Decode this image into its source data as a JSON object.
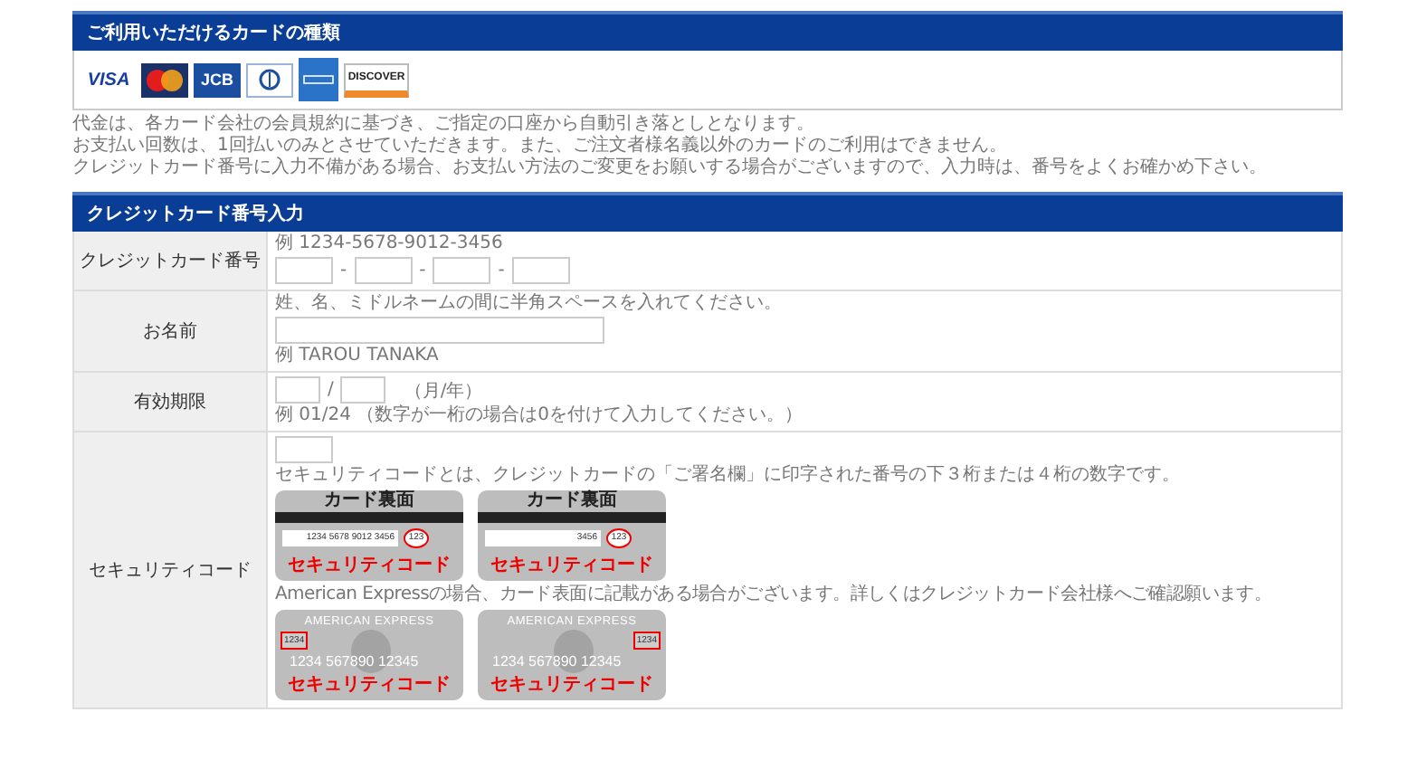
{
  "cards_section": {
    "title": "ご利用いただけるカードの種類",
    "card_brands": [
      {
        "kind": "visa",
        "label": "VISA"
      },
      {
        "kind": "mastercard"
      },
      {
        "kind": "jcb",
        "label": "JCB"
      },
      {
        "kind": "diners"
      },
      {
        "kind": "amex"
      },
      {
        "kind": "discover",
        "label": "DISCOVER"
      }
    ],
    "notes": [
      "代金は、各カード会社の会員規約に基づき、ご指定の口座から自動引き落としとなります。",
      "お支払い回数は、1回払いのみとさせていただきます。また、ご注文者様名義以外のカードのご利用はできません。",
      "クレジットカード番号に入力不備がある場合、お支払い方法のご変更をお願いする場合がございますので、入力時は、番号をよくお確かめ下さい。"
    ]
  },
  "form_section": {
    "title": "クレジットカード番号入力",
    "rows": [
      {
        "kind": "card_number",
        "label": "クレジットカード番号",
        "example": "例 1234-5678-9012-3456",
        "separators": [
          "-",
          "-",
          "-"
        ]
      },
      {
        "kind": "name",
        "label": "お名前",
        "note": "姓、名、ミドルネームの間に半角スペースを入れてください。",
        "example": "例 TAROU TANAKA"
      },
      {
        "kind": "expiry",
        "label": "有効期限",
        "separator": "/",
        "unit": "（月/年）",
        "example": "例 01/24 （数字が一桁の場合は0を付けて入力してください。）"
      },
      {
        "kind": "security",
        "label": "セキュリティコード",
        "description": "セキュリティコードとは、クレジットカードの「ご署名欄」に印字された番号の下３桁または４桁の数字です。",
        "amex_note": "American Expressの場合、カード表面に記載がある場合がございます。詳しくはクレジットカード会社様へご確認願います。",
        "card_images": [
          {
            "kind": "signature",
            "title": "カード裏面",
            "number": "1234 5678 9012 3456",
            "code": "123",
            "code_label": "セキュリティコード"
          },
          {
            "kind": "signature",
            "title": "カード裏面",
            "number": "3456",
            "code": "123",
            "code_label": "セキュリティコード"
          },
          {
            "kind": "amex",
            "title": "AMERICAN EXPRESS",
            "code": "1234",
            "number": "1234 567890 12345",
            "code_left": true,
            "code_label": "セキュリティコード"
          },
          {
            "kind": "amex",
            "title": "AMERICAN EXPRESS",
            "code": "1234",
            "number": "1234 567890 12345",
            "code_left": false,
            "code_label": "セキュリティコード"
          }
        ]
      }
    ]
  }
}
